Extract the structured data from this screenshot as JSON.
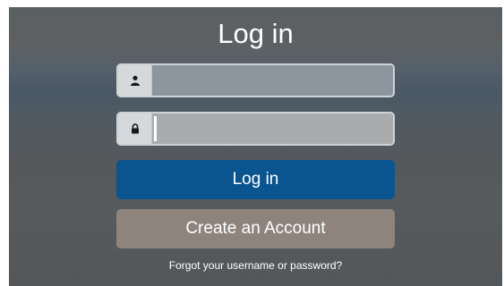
{
  "title": "Log in",
  "username_field": {
    "icon": "user-icon",
    "value": ""
  },
  "password_field": {
    "icon": "lock-icon",
    "value": ""
  },
  "buttons": {
    "login_label": "Log in",
    "create_account_label": "Create an Account"
  },
  "forgot_link": "Forgot your username or password?",
  "colors": {
    "login_button": "#0a5590",
    "create_button": "#8e847c",
    "text": "#ffffff"
  }
}
